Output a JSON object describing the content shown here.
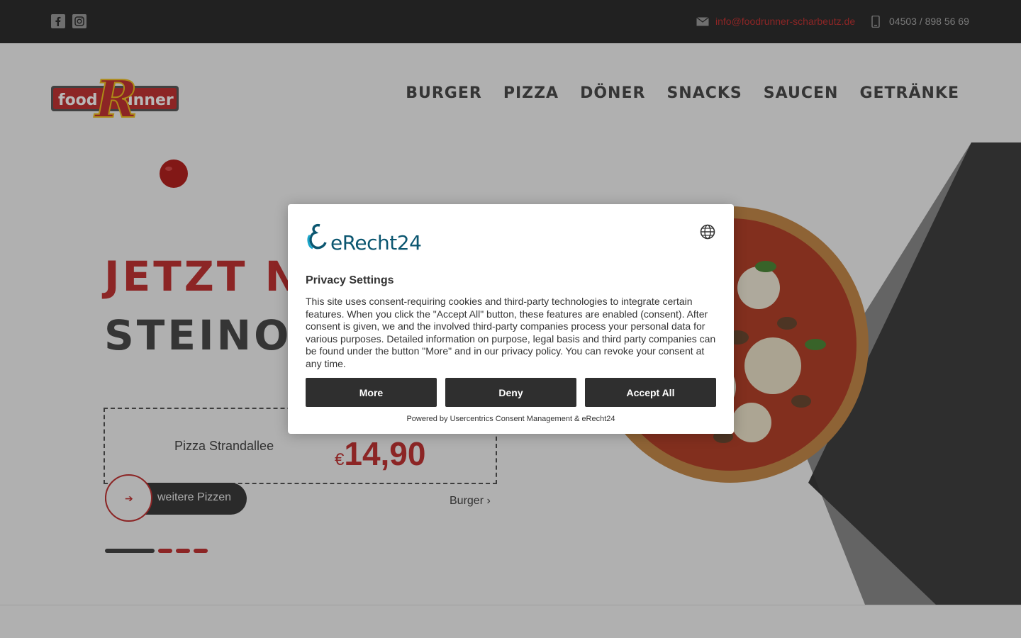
{
  "topbar": {
    "email": "info@foodrunner-scharbeutz.de",
    "phone": "04503 / 898 56 69",
    "icons": [
      "facebook-icon",
      "instagram-icon",
      "mail-icon",
      "phone-icon"
    ]
  },
  "logo": {
    "word1": "food",
    "word2": "unner",
    "letter": "R"
  },
  "nav": {
    "items": [
      "BURGER",
      "PIZZA",
      "DÖNER",
      "SNACKS",
      "SAUCEN",
      "GETRÄNKE"
    ]
  },
  "hero": {
    "headline1": "JETZT NE",
    "headline2": "STEINOFE",
    "product_name": "Pizza Strandallee",
    "currency": "€",
    "price": "14,90",
    "more_label": "weitere Pizzen",
    "next_label": "Burger",
    "slides_total": 4,
    "slide_active": 1
  },
  "consent": {
    "brand": "eRecht24",
    "title": "Privacy Settings",
    "body": "This site uses consent-requiring cookies and third-party technologies to integrate certain features. When you click the \"Accept All\" button, these features are enabled (consent). After consent is given, we and the involved third-party companies process your personal data for various purposes. Detailed information on purpose, legal basis and third party companies can be found under the button \"More\" and in our privacy policy. You can revoke your consent at any time.",
    "more_label": "More",
    "deny_label": "Deny",
    "accept_label": "Accept All",
    "powered_by": "Powered by Usercentrics Consent Management & eRecht24"
  },
  "colors": {
    "accent": "#c23434",
    "topbar": "#2e2e2e",
    "button": "#2f2f2f",
    "brand_teal": "#0b5670"
  }
}
